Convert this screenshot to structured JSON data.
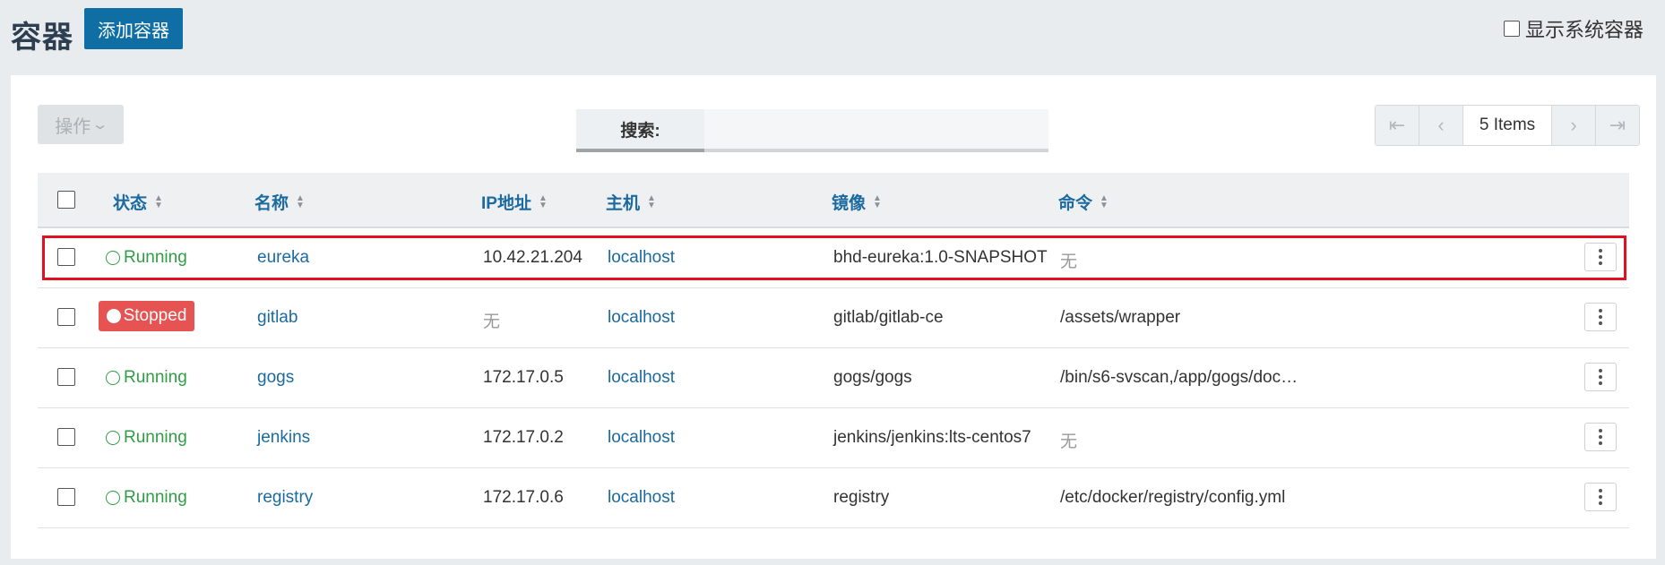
{
  "header": {
    "title": "容器",
    "add_button": "添加容器",
    "show_system_label": "显示系统容器"
  },
  "toolbar": {
    "actions_label": "操作",
    "search_label": "搜索:",
    "search_value": "",
    "item_count": "5 Items"
  },
  "table": {
    "columns": [
      "状态",
      "名称",
      "IP地址",
      "主机",
      "镜像",
      "命令"
    ],
    "rows": [
      {
        "state": "Running",
        "name": "eureka",
        "ip": "10.42.21.204",
        "host": "localhost",
        "image": "bhd-eureka:1.0-SNAPSHOT",
        "command": "无"
      },
      {
        "state": "Stopped",
        "name": "gitlab",
        "ip": "无",
        "host": "localhost",
        "image": "gitlab/gitlab-ce",
        "command": "/assets/wrapper"
      },
      {
        "state": "Running",
        "name": "gogs",
        "ip": "172.17.0.5",
        "host": "localhost",
        "image": "gogs/gogs",
        "command": "/bin/s6-svscan,/app/gogs/doc…"
      },
      {
        "state": "Running",
        "name": "jenkins",
        "ip": "172.17.0.2",
        "host": "localhost",
        "image": "jenkins/jenkins:lts-centos7",
        "command": "无"
      },
      {
        "state": "Running",
        "name": "registry",
        "ip": "172.17.0.6",
        "host": "localhost",
        "image": "registry",
        "command": "/etc/docker/registry/config.yml"
      }
    ]
  },
  "colors": {
    "primary": "#0f6fa5",
    "running": "#2f9e44",
    "stopped": "#e55353",
    "highlight": "#e30f1f",
    "link": "#1b6aa0"
  },
  "icons": [
    "first-page-icon",
    "prev-page-icon",
    "next-page-icon",
    "last-page-icon",
    "sort-icon",
    "more-vertical-icon",
    "chevron-down-icon"
  ]
}
